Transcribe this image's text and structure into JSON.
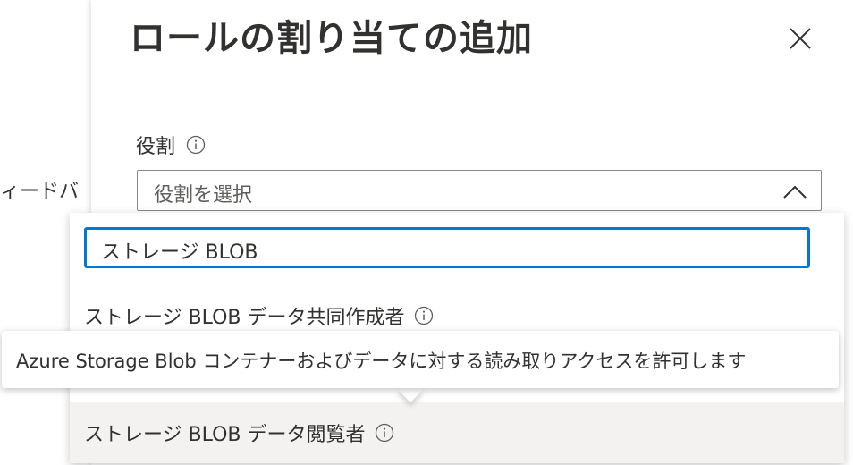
{
  "background": {
    "feedback_fragment": "ィードバ"
  },
  "panel": {
    "title": "ロールの割り当ての追加",
    "close_icon": "close-icon"
  },
  "role_field": {
    "label": "役割",
    "info_icon": "info-icon",
    "placeholder": "役割を選択",
    "chevron_icon": "chevron-up-icon"
  },
  "dropdown": {
    "search_value": "ストレージ BLOB",
    "options": [
      {
        "label": "ストレージ BLOB データ共同作成者",
        "icon": "info-icon"
      },
      {
        "label": "ストレージ BLOB データ閲覧者",
        "icon": "info-icon"
      }
    ]
  },
  "tooltip": {
    "text": "Azure Storage Blob コンテナーおよびデータに対する読み取りアクセスを許可します"
  },
  "colors": {
    "accent": "#0078d4",
    "text": "#323130",
    "hover": "#f3f2f1",
    "border": "#8a8886"
  }
}
